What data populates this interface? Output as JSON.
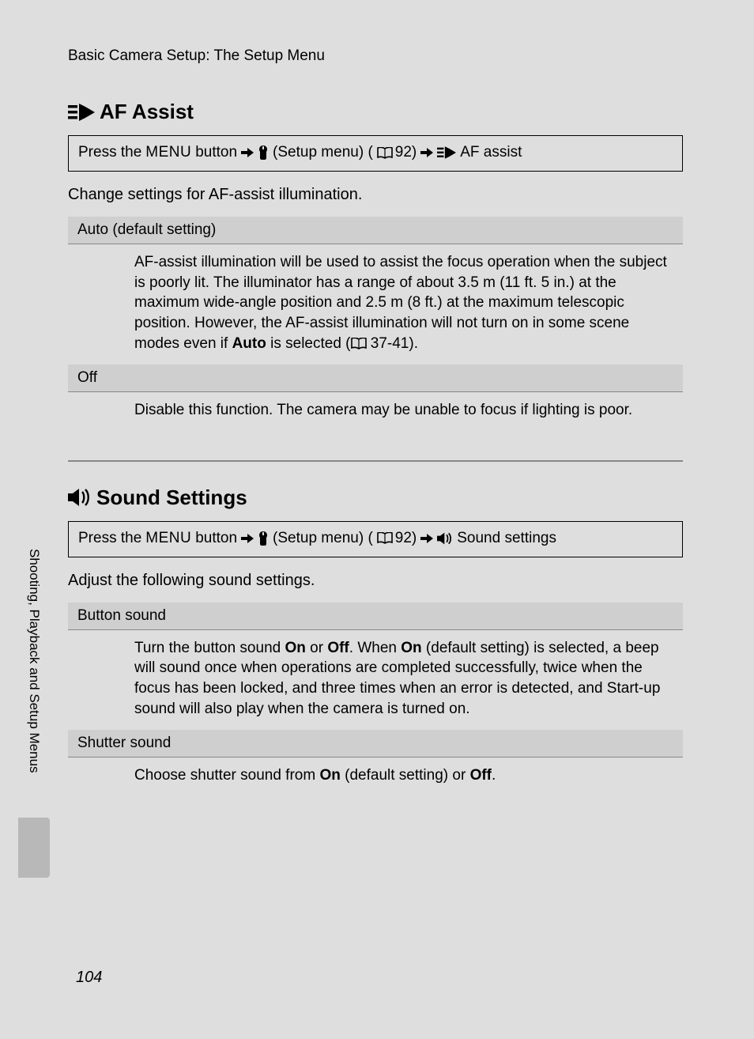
{
  "header": {
    "breadcrumb": "Basic Camera Setup: The Setup Menu"
  },
  "sections": [
    {
      "icon": "af-assist-icon",
      "title": "AF Assist",
      "nav": {
        "press_the": "Press the",
        "menu": "MENU",
        "button": "button",
        "setup_menu": "(Setup menu) (",
        "page_ref_1": "92)",
        "item": "AF assist"
      },
      "intro": "Change settings for AF-assist illumination.",
      "options": [
        {
          "header": "Auto (default setting)",
          "body_pre": "AF-assist illumination will be used to assist the focus operation when the subject is poorly lit. The illuminator has a range of about 3.5 m (11 ft. 5 in.) at the maximum wide-angle position and 2.5 m (8 ft.) at the maximum telescopic position. However, the AF-assist illumination will not turn on in some scene modes even if ",
          "body_bold": "Auto",
          "body_post": " is selected (",
          "body_ref": "37-41).",
          "has_ref": true
        },
        {
          "header": "Off",
          "body_pre": "Disable this function. The camera may be unable to focus if lighting is poor.",
          "body_bold": "",
          "body_post": "",
          "body_ref": "",
          "has_ref": false
        }
      ]
    },
    {
      "icon": "sound-icon",
      "title": "Sound Settings",
      "nav": {
        "press_the": "Press the",
        "menu": "MENU",
        "button": "button",
        "setup_menu": "(Setup menu) (",
        "page_ref_1": "92)",
        "item": "Sound settings"
      },
      "intro": "Adjust the following sound settings.",
      "options": [
        {
          "header": "Button sound",
          "body_segments": [
            {
              "t": "Turn the button sound ",
              "b": false
            },
            {
              "t": "On",
              "b": true
            },
            {
              "t": " or ",
              "b": false
            },
            {
              "t": "Off",
              "b": true
            },
            {
              "t": ". When ",
              "b": false
            },
            {
              "t": "On",
              "b": true
            },
            {
              "t": " (default setting) is selected, a beep will sound once when operations are completed successfully, twice when the focus has been locked, and three times when an error is detected, and Start-up sound will also play when the camera is turned on.",
              "b": false
            }
          ]
        },
        {
          "header": "Shutter sound",
          "body_segments": [
            {
              "t": "Choose shutter sound from ",
              "b": false
            },
            {
              "t": "On",
              "b": true
            },
            {
              "t": " (default setting) or ",
              "b": false
            },
            {
              "t": "Off",
              "b": true
            },
            {
              "t": ".",
              "b": false
            }
          ]
        }
      ]
    }
  ],
  "side_label": "Shooting, Playback and Setup Menus",
  "page_number": "104"
}
